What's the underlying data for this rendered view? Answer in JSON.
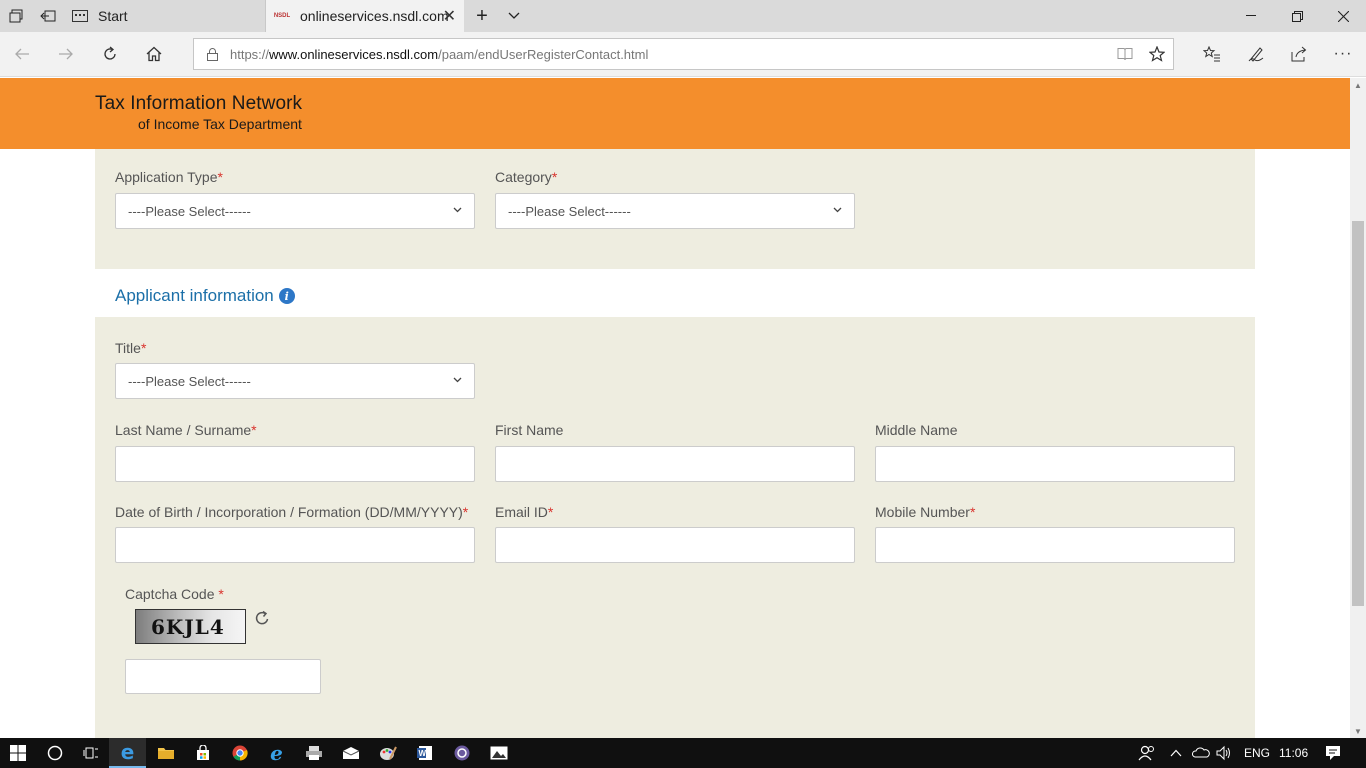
{
  "browser": {
    "tabs": [
      {
        "label": "Start",
        "icon": "start-page-icon"
      },
      {
        "label": "onlineservices.nsdl.com",
        "icon": "nsdl-favicon"
      }
    ],
    "url_prefix": "https://",
    "url_host": "www.onlineservices.nsdl.com",
    "url_path": "/paam/endUserRegisterContact.html",
    "favicon_text": "NSDL"
  },
  "header": {
    "line1": "Tax Information Network",
    "line2": "of Income Tax Department",
    "bg_color": "#f48e2c"
  },
  "form": {
    "application_type": {
      "label": "Application Type",
      "required": "*",
      "value": "----Please Select------"
    },
    "category": {
      "label": "Category",
      "required": "*",
      "value": "----Please Select------"
    },
    "section_title": "Applicant information",
    "title": {
      "label": "Title",
      "required": "*",
      "value": "----Please Select------"
    },
    "last_name": {
      "label": "Last Name / Surname",
      "required": "*",
      "value": ""
    },
    "first_name": {
      "label": "First Name",
      "value": ""
    },
    "middle_name": {
      "label": "Middle Name",
      "value": ""
    },
    "dob": {
      "label": "Date of Birth / Incorporation / Formation (DD/MM/YYYY)",
      "required": "*",
      "value": ""
    },
    "email": {
      "label": "Email ID",
      "required": "*",
      "value": ""
    },
    "mobile": {
      "label": "Mobile Number",
      "required": "*",
      "value": ""
    },
    "captcha": {
      "label": "Captcha Code ",
      "required": "*",
      "image_text": "6KJL4",
      "value": ""
    }
  },
  "taskbar": {
    "language": "ENG",
    "time": "11:06"
  }
}
